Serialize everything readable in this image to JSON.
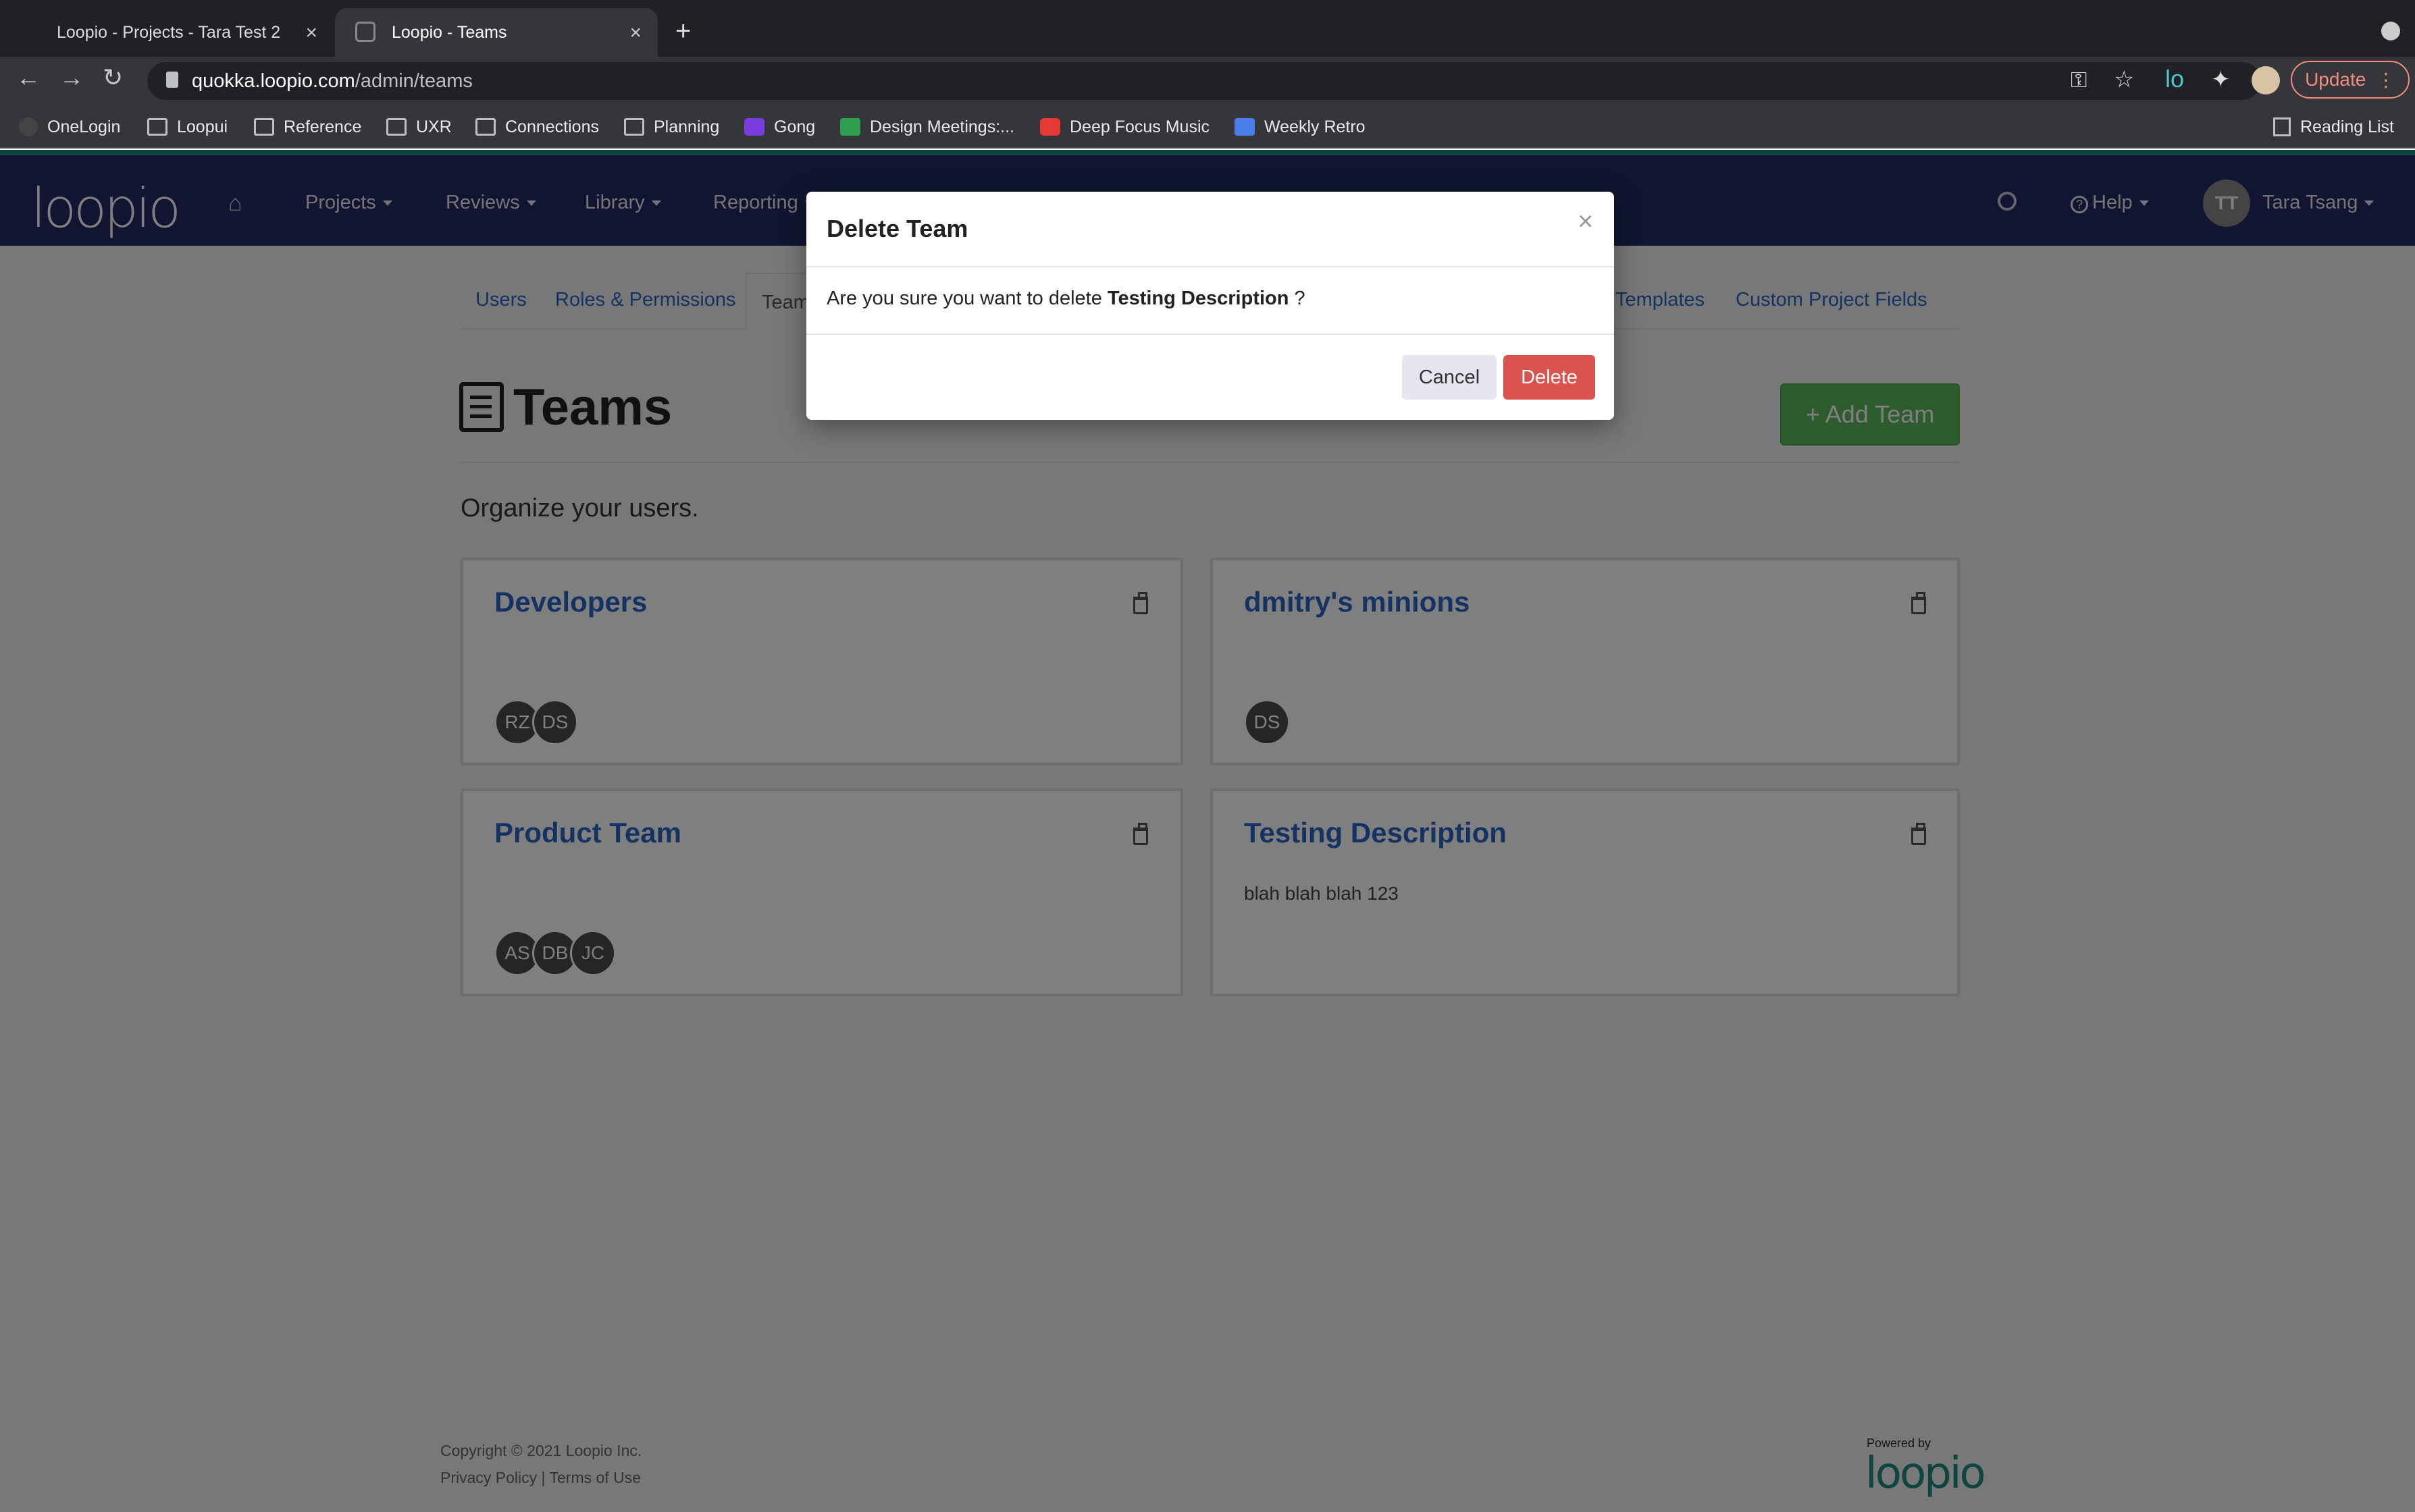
{
  "browser": {
    "tabs": [
      {
        "title": "Loopio - Projects - Tara Test 2"
      },
      {
        "title": "Loopio - Teams"
      }
    ],
    "url_host": "quokka.loopio.com",
    "url_path": "/admin/teams",
    "update_label": "Update",
    "bookmarks": [
      "OneLogin",
      "Loopui",
      "Reference",
      "UXR",
      "Connections",
      "Planning",
      "Gong",
      "Design Meetings:...",
      "Deep Focus Music",
      "Weekly Retro"
    ],
    "reading_list": "Reading List"
  },
  "app": {
    "logo": "loopio",
    "nav": [
      "Projects",
      "Reviews",
      "Library",
      "Reporting"
    ],
    "help": "Help",
    "user_initials": "TT",
    "user_name": "Tara Tsang"
  },
  "subtabs": {
    "users": "Users",
    "roles": "Roles & Permissions",
    "teams": "Teams",
    "templates": "Templates",
    "custom_fields": "Custom Project Fields"
  },
  "page": {
    "title": "Teams",
    "subtitle": "Organize your users.",
    "add_button": "+ Add Team"
  },
  "teams": [
    {
      "name": "Developers",
      "members": [
        "RZ",
        "DS"
      ],
      "description": ""
    },
    {
      "name": "dmitry's minions",
      "members": [
        "DS"
      ],
      "description": ""
    },
    {
      "name": "Product Team",
      "members": [
        "AS",
        "DB",
        "JC"
      ],
      "description": ""
    },
    {
      "name": "Testing Description",
      "members": [],
      "description": "blah blah blah 123"
    }
  ],
  "footer": {
    "copyright": "Copyright © 2021 Loopio Inc.",
    "privacy": "Privacy Policy",
    "separator": "|",
    "terms": "Terms of Use",
    "powered_by": "Powered by",
    "powered_logo": "loopio"
  },
  "modal": {
    "title": "Delete Team",
    "close": "×",
    "message_prefix": "Are you sure you want to delete",
    "team_name": "Testing Description",
    "message_suffix": "?",
    "cancel": "Cancel",
    "delete": "Delete"
  },
  "colors": {
    "nav_bg": "#252a63",
    "link": "#2b66c4",
    "add_green": "#5cb85c",
    "delete_red": "#d9534f"
  }
}
